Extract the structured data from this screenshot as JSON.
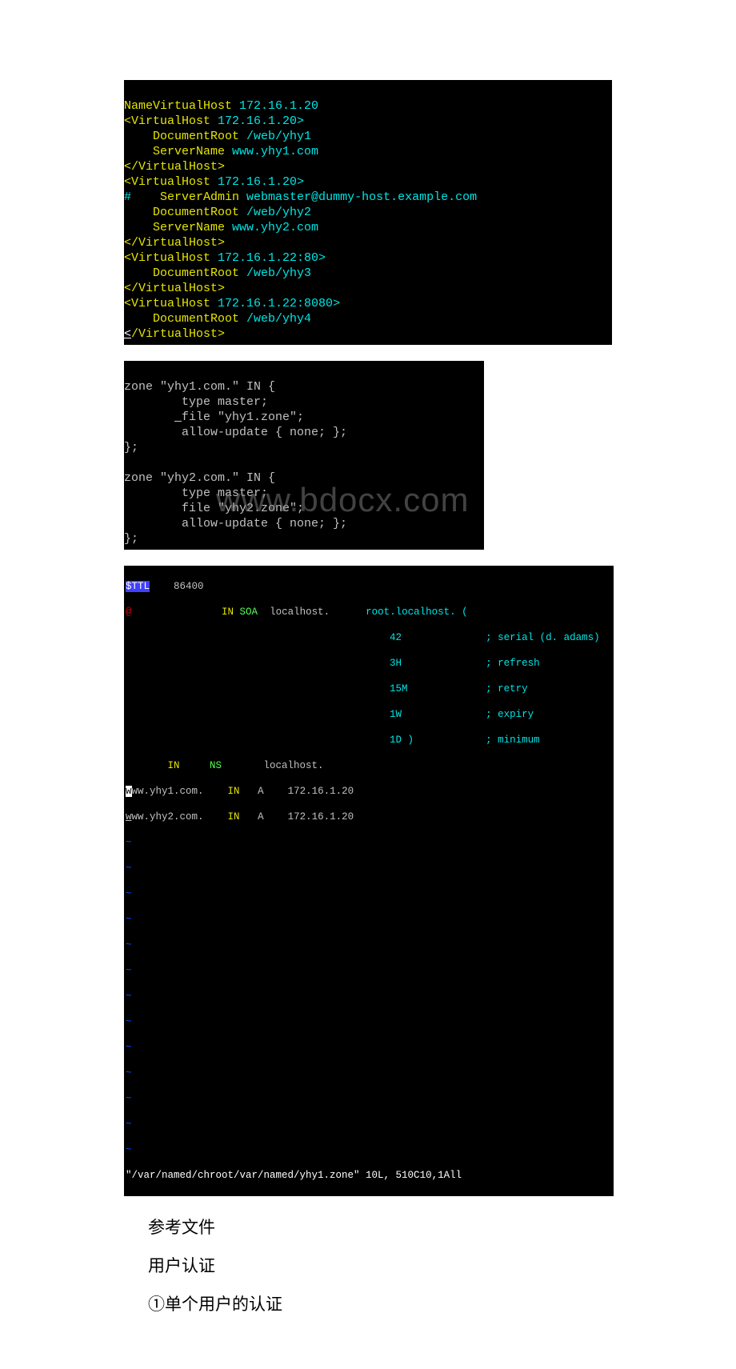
{
  "terminal1": {
    "l1_a": "NameVirtualHost ",
    "l1_b": "172.16.1.20",
    "l2_a": "<VirtualHost ",
    "l2_b": "172.16.1.20>",
    "l3_a": "    DocumentRoot ",
    "l3_b": "/web/yhy1",
    "l4_a": "    ServerName ",
    "l4_b": "www.yhy1.com",
    "l5": "</VirtualHost>",
    "l6_a": "<VirtualHost ",
    "l6_b": "172.16.1.20>",
    "l7_a": "#",
    "l7_b": "    ServerAdmin ",
    "l7_c": "webmaster@dummy-host.example.com",
    "l8_a": "    DocumentRoot ",
    "l8_b": "/web/yhy2",
    "l9_a": "    ServerName ",
    "l9_b": "www.yhy2.com",
    "l10": "</VirtualHost>",
    "l11_a": "<VirtualHost ",
    "l11_b": "172.16.1.22:80>",
    "l12_a": "    DocumentRoot ",
    "l12_b": "/web/yhy3",
    "l13": "</VirtualHost>",
    "l14_a": "<VirtualHost ",
    "l14_b": "172.16.1.22:8080>",
    "l15_a": "    DocumentRoot ",
    "l15_b": "/web/yhy4",
    "l16_a": "<",
    "l16_b": "/VirtualHost>"
  },
  "terminal2": {
    "l1": "zone \"yhy1.com.\" IN {",
    "l2": "        type master;",
    "l3_a": "       ",
    "l3_b": "_",
    "l3_c": "file \"yhy1.zone\";",
    "l4": "        allow-update { none; };",
    "l5": "};",
    "blank": " ",
    "l6": "zone \"yhy2.com.\" IN {",
    "l7": "        type master;",
    "l8": "        file \"yhy2.zone\";",
    "l9": "        allow-update { none; };",
    "l10": "};"
  },
  "watermark": "www.bdocx.com",
  "terminal3": {
    "l1_a": "$TTL",
    "l1_b": "    86400",
    "l2_a": "@",
    "l2_b": "               IN",
    "l2_c": " SOA",
    "l2_d": "  localhost.      ",
    "l2_e": "root.localhost. (",
    "l3_a": "                                            42",
    "l3_b": "              ; serial (d. adams)",
    "l4_a": "                                            3H",
    "l4_b": "              ; refresh",
    "l5_a": "                                            15M",
    "l5_b": "             ; retry",
    "l6_a": "                                            1W",
    "l6_b": "              ; expiry",
    "l7_a": "                                            1D )",
    "l7_b": "            ; minimum",
    "l8_a": "       IN",
    "l8_b": "     NS",
    "l8_c": "       localhost.",
    "l9_a": "w",
    "l9_b": "ww.yhy1.com.    ",
    "l9_c": "IN",
    "l9_d": "   A    172.16.1.20",
    "l10_a": "w",
    "l10_b": "ww.yhy2.com.    ",
    "l10_c": "IN",
    "l10_d": "   A    172.16.1.20",
    "tilde": "~",
    "status_l": "\"/var/named/chroot/var/named/yhy1.zone\" 10L, 510C",
    "status_m": "10,1",
    "status_r": "All"
  },
  "paragraphs": {
    "p1": "参考文件",
    "p2": "用户认证",
    "p3": "①单个用户的认证"
  }
}
